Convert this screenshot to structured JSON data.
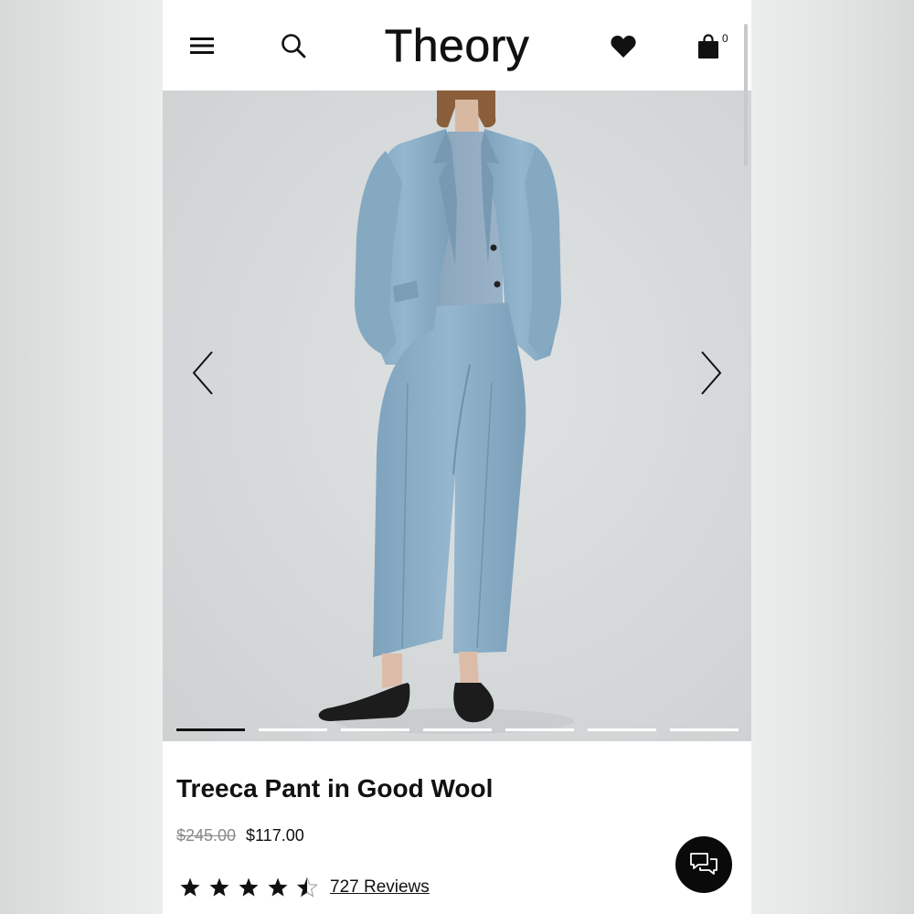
{
  "header": {
    "logo_text": "Theory",
    "menu_icon": "hamburger-menu-icon",
    "search_icon": "search-icon",
    "wishlist_icon": "heart-icon",
    "bag_icon": "shopping-bag-icon",
    "bag_count": "0"
  },
  "gallery": {
    "prev_icon": "chevron-left-icon",
    "next_icon": "chevron-right-icon",
    "slide_count": 7,
    "active_slide": 1
  },
  "product": {
    "title": "Treeca Pant in Good Wool",
    "original_price": "$245.00",
    "sale_price": "$117.00",
    "rating": 4.5,
    "rating_max": 5,
    "reviews_label": "727 Reviews"
  },
  "chat": {
    "icon": "chat-bubbles-icon"
  },
  "colors": {
    "text": "#111111",
    "muted_price": "#8a8a8a",
    "suit_blue": "#8fb1c9",
    "hero_bg": "#d8dcdd",
    "chat_bg": "#0a0a0a"
  }
}
